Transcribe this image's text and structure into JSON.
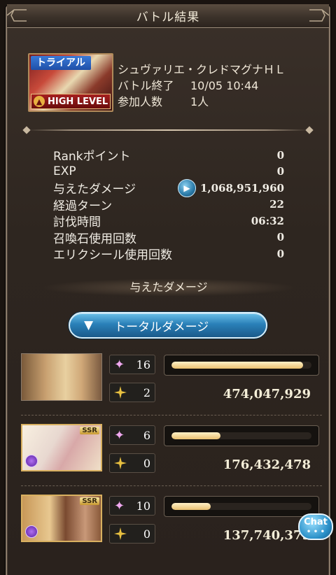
{
  "header": {
    "title": "バトル結果"
  },
  "quest": {
    "badge": "トライアル",
    "level_label": "HIGH LEVEL",
    "name": "シュヴァリエ・クレドマグナＨＬ",
    "end_label": "バトル終了",
    "end_value": "10/05 10:44",
    "participants_label": "参加人数",
    "participants_value": "1人"
  },
  "stats": [
    {
      "label": "Rankポイント",
      "value": "0"
    },
    {
      "label": "EXP",
      "value": "0"
    },
    {
      "label": "与えたダメージ",
      "value": "1,068,951,960"
    },
    {
      "label": "経過ターン",
      "value": "22"
    },
    {
      "label": "討伐時間",
      "value": "06:32"
    },
    {
      "label": "召喚石使用回数",
      "value": "0"
    },
    {
      "label": "エリクシール使用回数",
      "value": "0"
    }
  ],
  "section_title": "与えたダメージ",
  "total_button": {
    "arrow": "▼",
    "label": "トータルダメージ"
  },
  "characters": [
    {
      "portrait": "main-character-portrait",
      "ssr": false,
      "hits": "16",
      "specials": "2",
      "damage": "474,047,929",
      "share": 0.94
    },
    {
      "portrait": "character-portrait",
      "ssr": true,
      "hits": "6",
      "specials": "0",
      "damage": "176,432,478",
      "share": 0.35
    },
    {
      "portrait": "character-portrait",
      "ssr": true,
      "hits": "10",
      "specials": "0",
      "damage": "137,740,379",
      "share": 0.28
    }
  ],
  "chat": {
    "label": "Chat"
  },
  "colors": {
    "accent_blue": "#2a80b8",
    "gold": "#e8c070",
    "panel": "#2e2620"
  }
}
